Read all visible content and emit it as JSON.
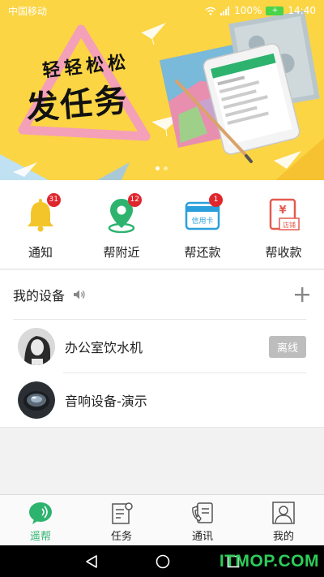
{
  "status_bar": {
    "carrier": "中国移动",
    "battery_percent": "100%",
    "time": "14:40"
  },
  "banner": {
    "slogan_top": "轻轻松松",
    "slogan_main": "发任务",
    "slide_count": 2,
    "active_slide": 1,
    "background_color": "#fbd544"
  },
  "quick_actions": [
    {
      "icon": "bell-icon",
      "label": "通知",
      "badge": "31"
    },
    {
      "icon": "location-pin-icon",
      "label": "帮附近",
      "badge": "12"
    },
    {
      "icon": "credit-card-icon",
      "label": "帮还款",
      "badge": "1",
      "icon_text": "信用卡"
    },
    {
      "icon": "receipt-icon",
      "label": "帮收款",
      "badge": "",
      "icon_text": "店铺"
    }
  ],
  "devices": {
    "title": "我的设备",
    "items": [
      {
        "name": "办公室饮水机",
        "status": "离线",
        "avatar": "woman-portrait"
      },
      {
        "name": "音响设备-演示",
        "status": "",
        "avatar": "speaker"
      }
    ]
  },
  "tabs": [
    {
      "icon": "chat-bubble-icon",
      "label": "遥帮",
      "active": true
    },
    {
      "icon": "task-doc-icon",
      "label": "任务",
      "active": false
    },
    {
      "icon": "phone-book-icon",
      "label": "通讯",
      "active": false
    },
    {
      "icon": "person-icon",
      "label": "我的",
      "active": false
    }
  ],
  "watermark": "ITMOP.COM",
  "colors": {
    "accent_green": "#2db36e",
    "badge_red": "#e0262d",
    "banner_yellow": "#fbd544"
  }
}
